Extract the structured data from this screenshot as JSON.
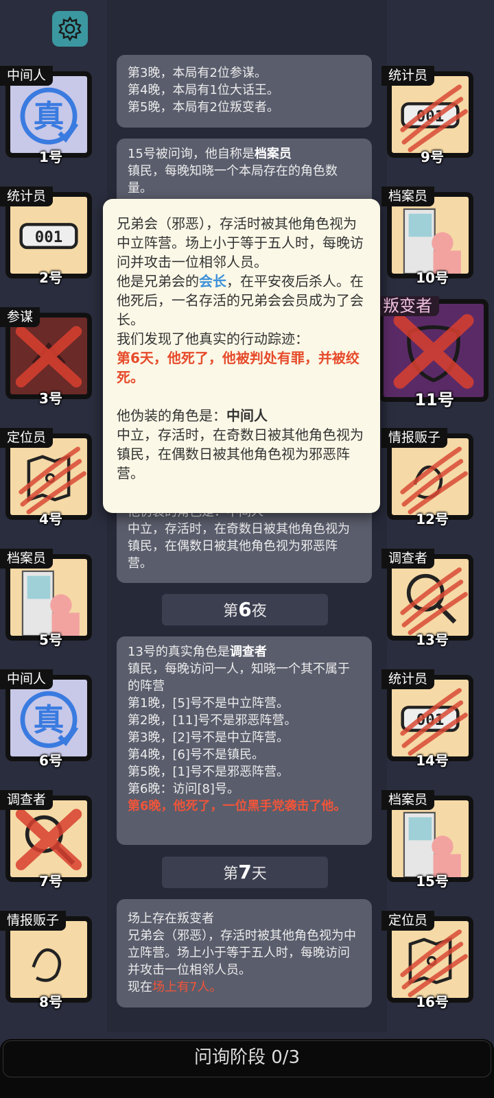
{
  "settings_icon": "gear-icon",
  "feed": {
    "card1": [
      "第3晚，本局有2位参谋。",
      "第4晚，本局有1位大话王。",
      "第5晚，本局有2位叛变者。"
    ],
    "card2_title_prefix": "15号被问询，他自称是",
    "card2_role": "档案员",
    "card2_desc": "镇民，每晚知晓一个本局存在的角色数量。",
    "card3_hidden": "他伪装的角色是：中间人",
    "card3_desc": "中立，存活时，在奇数日被其他角色视为镇民，在偶数日被其他角色视为邪恶阵营。",
    "night6_prefix": "第",
    "night6_num": "6",
    "night6_suffix": "夜",
    "card4_prefix": "13号的真实角色是",
    "card4_role": "调查者",
    "card4_lines": [
      "镇民，每晚访问一人，知晓一个其不属于的阵营",
      "第1晚，[5]号不是中立阵营。",
      "第2晚，[11]号不是邪恶阵营。",
      "第3晚，[2]号不是中立阵营。",
      "第4晚，[6]号不是镇民。",
      "第5晚，[1]号不是邪恶阵营。",
      "第6晚：访问[8]号。"
    ],
    "card4_death": "第6晚，他死了，一位黑手党袭击了他。",
    "day7_prefix": "第",
    "day7_num": "7",
    "day7_suffix": "天",
    "card5_lines": [
      "场上存在叛变者",
      "兄弟会（邪恶），存活时被其他角色视为中立阵营。场上小于等于五人时，每晚访问并攻击一位相邻人员。"
    ],
    "card5_tail_prefix": "现在",
    "card5_tail_red": "场上有7人。"
  },
  "popup": {
    "para1": "兄弟会（邪恶），存活时被其他角色视为中立阵营。场上小于等于五人时，每晚访问并攻击一位相邻人员。",
    "para2_prefix": "他是兄弟会的",
    "para2_blue": "会长",
    "para2_suffix": "，在平安夜后杀人。在他死后，一名存活的兄弟会会员成为了会长。",
    "para3": "我们发现了他真实的行动踪迹：",
    "para4_red": "第6天，他死了，他被判处有罪，并被绞死。",
    "para5_prefix": "他伪装的角色是：",
    "para5_role": "中间人",
    "para6": "中立，存活时，在奇数日被其他角色视为镇民，在偶数日被其他角色视为邪恶阵营。"
  },
  "players_left": [
    {
      "role": "中间人",
      "num": "1号",
      "icon": "true-badge-icon",
      "bg": "#c8c8e8"
    },
    {
      "role": "统计员",
      "num": "2号",
      "icon": "counter-icon",
      "bg": "#f5d9a6"
    },
    {
      "role": "参谋",
      "num": "3号",
      "icon": "skull-icon",
      "bg": "#6a2a28"
    },
    {
      "role": "定位员",
      "num": "4号",
      "icon": "map-icon",
      "bg": "#f5d9a6"
    },
    {
      "role": "档案员",
      "num": "5号",
      "icon": "bookshelf-icon",
      "bg": "#f5d9a6"
    },
    {
      "role": "中间人",
      "num": "6号",
      "icon": "true-badge-icon",
      "bg": "#c8c8e8"
    },
    {
      "role": "调查者",
      "num": "7号",
      "icon": "magnifier-icon",
      "bg": "#f5d9a6"
    },
    {
      "role": "情报贩子",
      "num": "8号",
      "icon": "whisper-icon",
      "bg": "#f5d9a6"
    }
  ],
  "players_right": [
    {
      "role": "统计员",
      "num": "9号",
      "icon": "counter-icon",
      "bg": "#f5d9a6"
    },
    {
      "role": "档案员",
      "num": "10号",
      "icon": "bookshelf-icon",
      "bg": "#f5d9a6"
    },
    {
      "role": "叛变者",
      "num": "11号",
      "icon": "mask-icon",
      "bg": "#5a2a66"
    },
    {
      "role": "情报贩子",
      "num": "12号",
      "icon": "whisper-icon",
      "bg": "#f5d9a6"
    },
    {
      "role": "调查者",
      "num": "13号",
      "icon": "magnifier-icon",
      "bg": "#f5d9a6"
    },
    {
      "role": "统计员",
      "num": "14号",
      "icon": "counter-icon",
      "bg": "#f5d9a6"
    },
    {
      "role": "档案员",
      "num": "15号",
      "icon": "bookshelf-icon",
      "bg": "#f5d9a6"
    },
    {
      "role": "定位员",
      "num": "16号",
      "icon": "map-icon",
      "bg": "#f5d9a6"
    }
  ],
  "phase": "问询阶段 0/3"
}
